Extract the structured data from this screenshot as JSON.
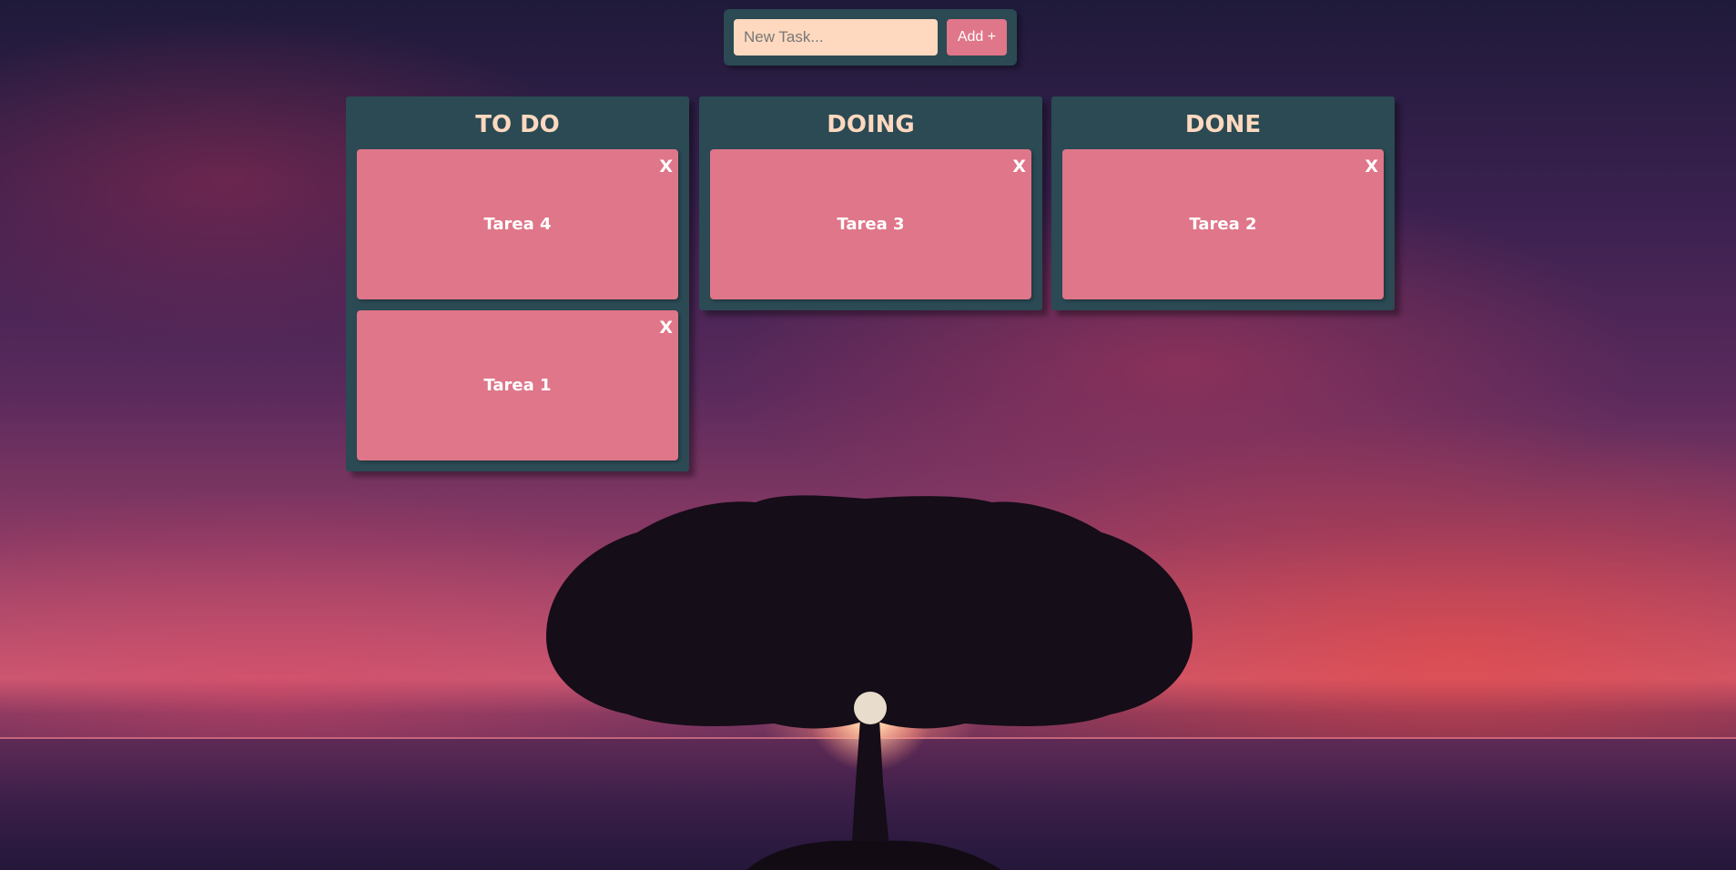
{
  "add_bar": {
    "input_placeholder": "New Task...",
    "input_value": "",
    "add_label": "Add +"
  },
  "columns": [
    {
      "title": "TO DO",
      "cards": [
        {
          "label": "Tarea 4",
          "delete_label": "X"
        },
        {
          "label": "Tarea 1",
          "delete_label": "X"
        }
      ]
    },
    {
      "title": "DOING",
      "cards": [
        {
          "label": "Tarea 3",
          "delete_label": "X"
        }
      ]
    },
    {
      "title": "DONE",
      "cards": [
        {
          "label": "Tarea 2",
          "delete_label": "X"
        }
      ]
    }
  ],
  "colors": {
    "panel": "#2b4a54",
    "card": "#e07689",
    "input": "#ffd9bf",
    "title": "#ffd9bf"
  }
}
